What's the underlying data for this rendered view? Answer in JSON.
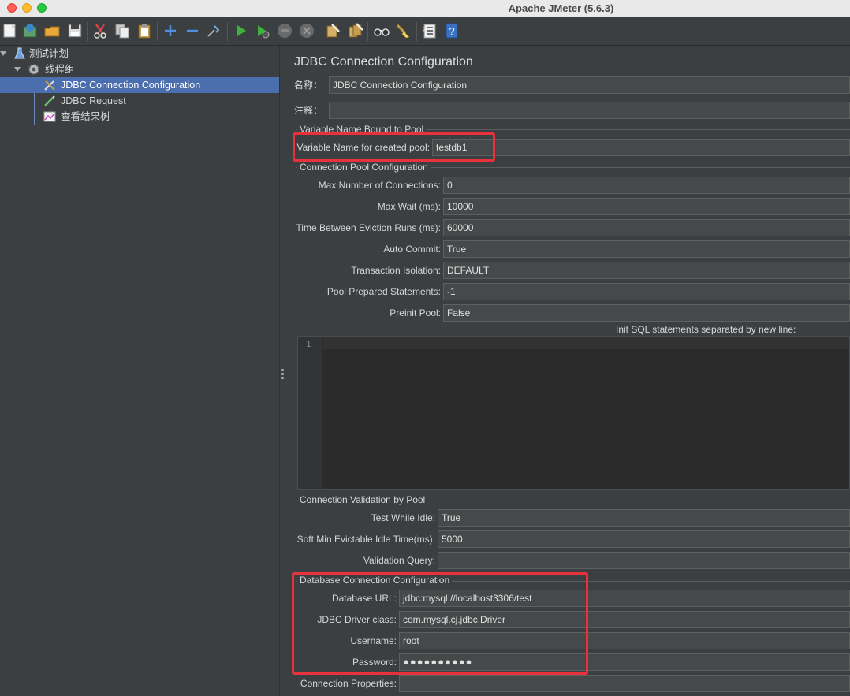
{
  "window": {
    "title": "Apache JMeter (5.6.3)"
  },
  "toolbar": {
    "icons": [
      "new-icon",
      "templates-icon",
      "open-icon",
      "save-icon",
      "cut-icon",
      "copy-icon",
      "paste-icon",
      "expand-icon",
      "collapse-icon",
      "toggle-icon",
      "start-icon",
      "start-no-pause-icon",
      "stop-icon",
      "shutdown-icon",
      "clear-icon",
      "clear-all-icon",
      "search-icon",
      "reset-search-icon",
      "function-helper-icon",
      "help-icon"
    ]
  },
  "tree": {
    "items": [
      {
        "label": "测试计划",
        "icon": "test-plan-icon"
      },
      {
        "label": "线程组",
        "icon": "thread-group-icon"
      },
      {
        "label": "JDBC Connection Configuration",
        "icon": "config-tools-icon",
        "selected": true
      },
      {
        "label": "JDBC Request",
        "icon": "sampler-pen-icon"
      },
      {
        "label": "查看结果树",
        "icon": "listener-chart-icon"
      }
    ]
  },
  "panel": {
    "title": "JDBC Connection Configuration",
    "name_label": "名称：",
    "name_value": "JDBC Connection Configuration",
    "comment_label": "注释：",
    "comment_value": "",
    "var_group": "Variable Name Bound to Pool",
    "var_label": "Variable Name for created pool:",
    "var_value": "testdb1",
    "pool_group": "Connection Pool Configuration",
    "pool_fields": [
      {
        "label": "Max Number of Connections:",
        "value": "0"
      },
      {
        "label": "Max Wait (ms):",
        "value": "10000"
      },
      {
        "label": "Time Between Eviction Runs (ms):",
        "value": "60000"
      },
      {
        "label": "Auto Commit:",
        "value": "True"
      },
      {
        "label": "Transaction Isolation:",
        "value": "DEFAULT"
      },
      {
        "label": "Pool Prepared Statements:",
        "value": "-1"
      },
      {
        "label": "Preinit Pool:",
        "value": "False"
      }
    ],
    "init_sql_label": "Init SQL statements separated by new line:",
    "init_sql_line": "1",
    "validation_group": "Connection Validation by Pool",
    "validation_fields": [
      {
        "label": "Test While Idle:",
        "value": "True"
      },
      {
        "label": "Soft Min Evictable Idle Time(ms):",
        "value": "5000"
      },
      {
        "label": "Validation Query:",
        "value": ""
      }
    ],
    "db_group": "Database Connection Configuration",
    "db_fields": [
      {
        "label": "Database URL:",
        "value": "jdbc:mysql://localhost3306/test"
      },
      {
        "label": "JDBC Driver class:",
        "value": "com.mysql.cj.jdbc.Driver"
      },
      {
        "label": "Username:",
        "value": "root"
      },
      {
        "label": "Password:",
        "value": "●●●●●●●●●●"
      }
    ],
    "conn_props_label": "Connection Properties:",
    "conn_props_value": ""
  },
  "colors": {
    "highlight": "#e8323b",
    "selection": "#4b6eaf",
    "background": "#3c3f41"
  }
}
